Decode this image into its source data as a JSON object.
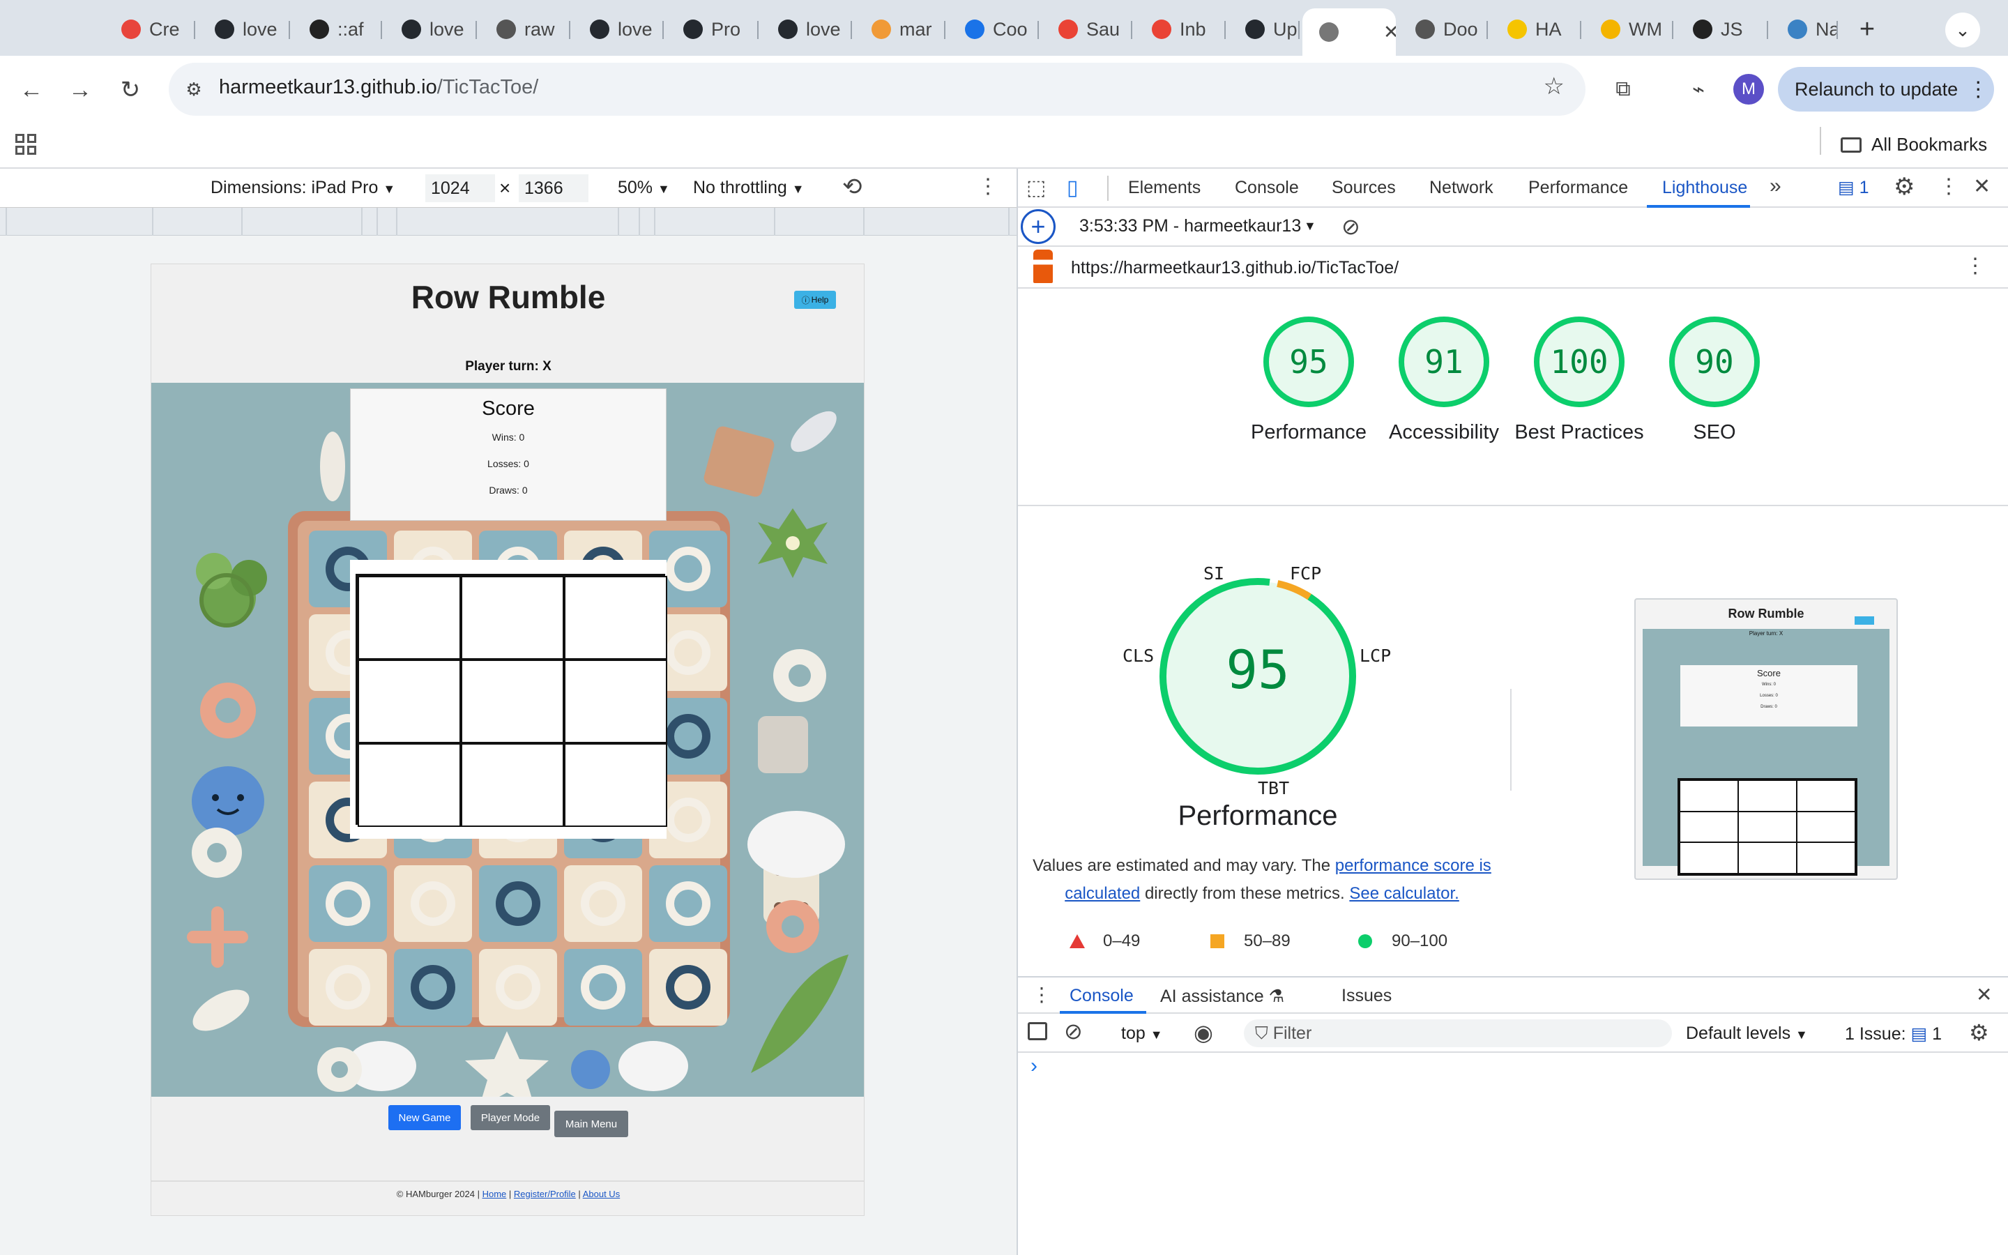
{
  "tabs": [
    {
      "label": "Cre",
      "icon": "opera-icon",
      "color": "#e8453c"
    },
    {
      "label": "love",
      "icon": "github-icon",
      "color": "#24292f"
    },
    {
      "label": "::af",
      "icon": "m-icon",
      "color": "#222"
    },
    {
      "label": "love",
      "icon": "github-icon",
      "color": "#24292f"
    },
    {
      "label": "raw",
      "icon": "globe-icon",
      "color": "#555"
    },
    {
      "label": "love",
      "icon": "github-icon",
      "color": "#24292f"
    },
    {
      "label": "Pro",
      "icon": "github-icon",
      "color": "#24292f"
    },
    {
      "label": "love",
      "icon": "github-icon",
      "color": "#24292f"
    },
    {
      "label": "mar",
      "icon": "g-icon",
      "color": "#f09a37"
    },
    {
      "label": "Coo",
      "icon": "calendar-icon",
      "color": "#1a73e8"
    },
    {
      "label": "Sau",
      "icon": "gmail-icon",
      "color": "#ea4335"
    },
    {
      "label": "Inb",
      "icon": "gmail-icon",
      "color": "#ea4335"
    },
    {
      "label": "Upl",
      "icon": "github-icon",
      "color": "#24292f"
    },
    {
      "label": "",
      "icon": "page-icon",
      "color": "#777",
      "active": true
    },
    {
      "label": "Doo",
      "icon": "globe-icon",
      "color": "#555"
    },
    {
      "label": "HA",
      "icon": "miro-icon",
      "color": "#f5c400"
    },
    {
      "label": "WM",
      "icon": "slides-icon",
      "color": "#f4b400"
    },
    {
      "label": "JS",
      "icon": "openai-icon",
      "color": "#222"
    },
    {
      "label": "Nav",
      "icon": "label-icon",
      "color": "#3b82c4"
    }
  ],
  "browser": {
    "url_host": "harmeetkaur13.github.io",
    "url_path": "/TicTacToe/",
    "profile_initial": "M",
    "relaunch": "Relaunch to update",
    "all_bookmarks": "All Bookmarks"
  },
  "device_toolbar": {
    "dimensions": "Dimensions: iPad Pro",
    "width": "1024",
    "height": "1366",
    "times": "×",
    "zoom": "50%",
    "throttle": "No throttling"
  },
  "game": {
    "title": "Row Rumble",
    "help": "Help",
    "turn": "Player turn: X",
    "score_title": "Score",
    "wins": "Wins: 0",
    "losses": "Losses: 0",
    "draws": "Draws: 0",
    "buttons": [
      "New Game",
      "Player Mode",
      "Main Menu"
    ],
    "footer_copy": "© HAMburger 2024 |",
    "footer_links": [
      "Home",
      "Register/Profile",
      "About Us"
    ],
    "footer_sep": "|"
  },
  "devtools": {
    "tabs": [
      "Elements",
      "Console",
      "Sources",
      "Network",
      "Performance",
      "Lighthouse"
    ],
    "active_tab": "Lighthouse",
    "issue_badge": "1",
    "report_time": "3:53:33 PM - harmeetkaur13",
    "report_url": "https://harmeetkaur13.github.io/TicTacToe/",
    "scores": [
      {
        "value": "95",
        "label": "Performance"
      },
      {
        "value": "91",
        "label": "Accessibility"
      },
      {
        "value": "100",
        "label": "Best Practices"
      },
      {
        "value": "90",
        "label": "SEO"
      }
    ],
    "metric_labels": {
      "si": "SI",
      "fcp": "FCP",
      "lcp": "LCP",
      "cls": "CLS",
      "tbt": "TBT"
    },
    "perf_score": "95",
    "perf_title": "Performance",
    "note_prefix": "Values are estimated and may vary. The ",
    "note_link1": "performance score is calculated",
    "note_mid": " directly from these metrics. ",
    "note_link2": "See calculator.",
    "legend": [
      {
        "range": "0–49",
        "color": "#e53935"
      },
      {
        "range": "50–89",
        "color": "#f5a623"
      },
      {
        "range": "90–100",
        "color": "#0cce6b"
      }
    ],
    "thumb": {
      "title": "Row Rumble",
      "turn": "Player turn: X",
      "score": "Score",
      "wins": "Wins: 0",
      "losses": "Losses: 0",
      "draws": "Draws: 0"
    }
  },
  "drawer": {
    "tabs": [
      "Console",
      "AI assistance",
      "Issues"
    ],
    "context": "top",
    "filter_placeholder": "Filter",
    "levels": "Default levels",
    "issues": "1 Issue:",
    "issues_count": "1",
    "prompt": "›"
  }
}
